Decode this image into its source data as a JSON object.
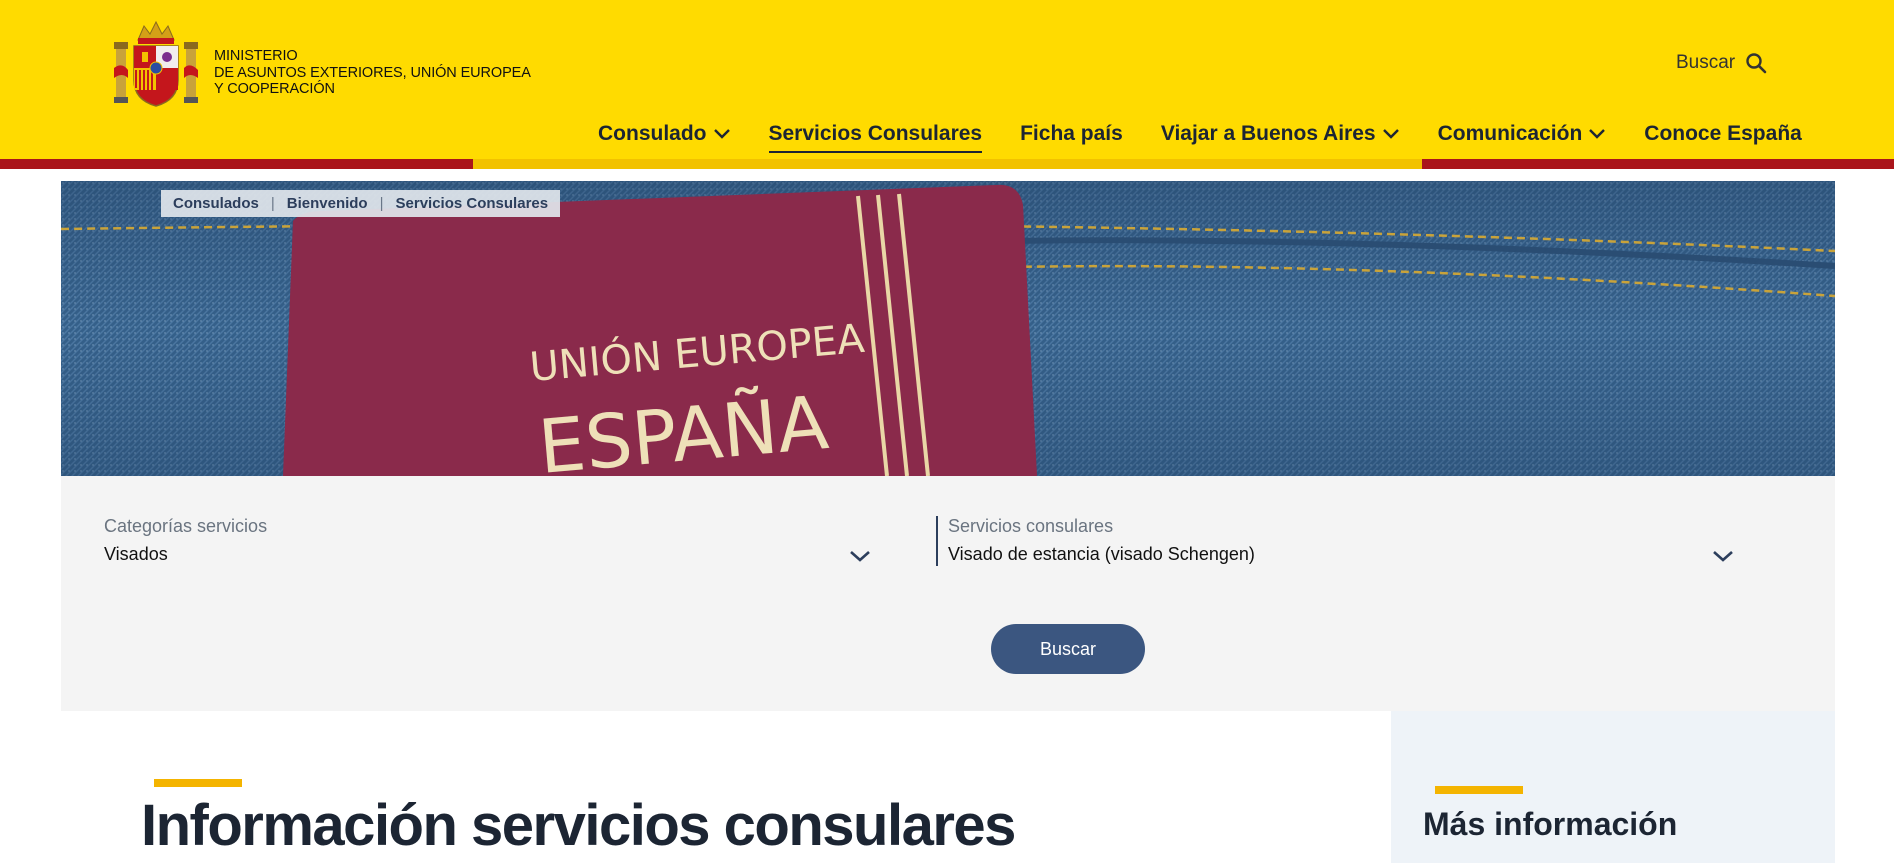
{
  "header": {
    "logo_lines": [
      "MINISTERIO",
      "DE ASUNTOS EXTERIORES, UNIÓN EUROPEA",
      "Y COOPERACIÓN"
    ],
    "search_label": "Buscar",
    "nav": [
      {
        "label": "Consulado",
        "has_dropdown": true
      },
      {
        "label": "Servicios Consulares",
        "has_dropdown": false,
        "active": true
      },
      {
        "label": "Ficha país",
        "has_dropdown": false
      },
      {
        "label": "Viajar a Buenos Aires",
        "has_dropdown": true
      },
      {
        "label": "Comunicación",
        "has_dropdown": true
      },
      {
        "label": "Conoce España",
        "has_dropdown": false
      }
    ]
  },
  "breadcrumb": [
    "Consulados",
    "Bienvenido",
    "Servicios Consulares"
  ],
  "hero": {
    "passport_line1": "UNIÓN EUROPEA",
    "passport_line2": "ESPAÑA"
  },
  "filter": {
    "category_label": "Categorías servicios",
    "category_value": "Visados",
    "service_label": "Servicios consulares",
    "service_value": "Visado de estancia (visado Schengen)",
    "button_label": "Buscar"
  },
  "main": {
    "title": "Información servicios consulares"
  },
  "sidebar": {
    "title": "Más información"
  },
  "colors": {
    "header_yellow": "#ffdb00",
    "flag_red": "#aa151b",
    "accent_yellow": "#f4b400",
    "button_blue": "#3b5680",
    "text_navy": "#1c2533"
  }
}
